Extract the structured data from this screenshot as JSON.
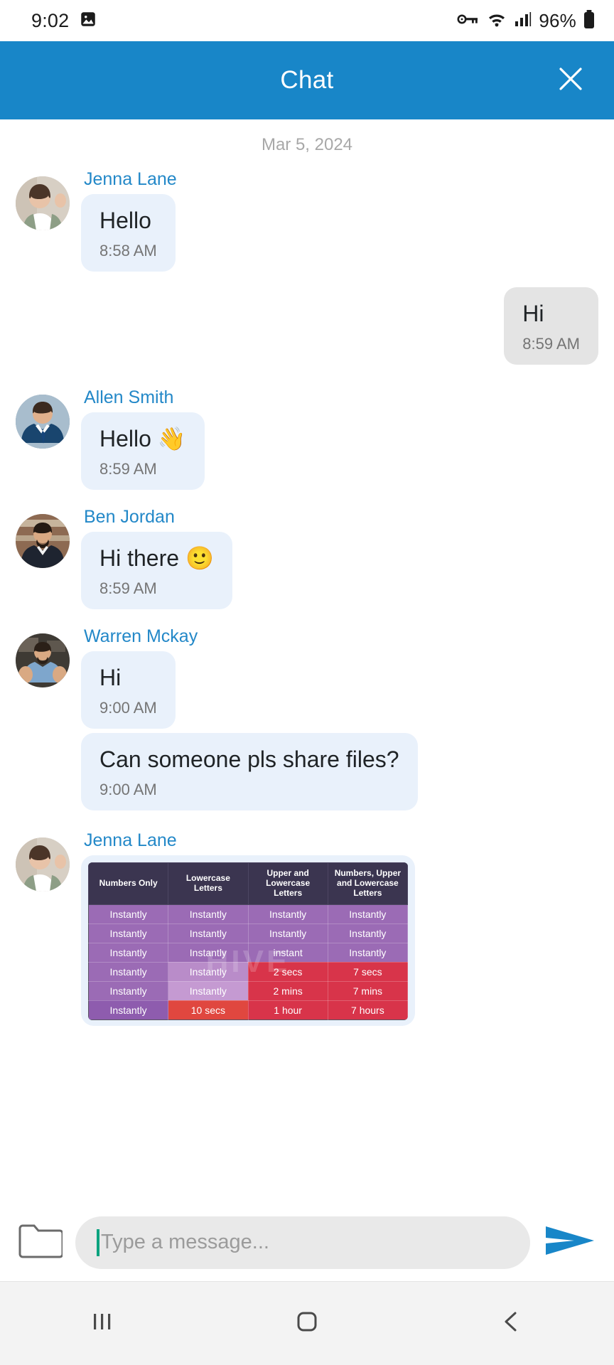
{
  "status_bar": {
    "time": "9:02",
    "battery_percent": "96%",
    "icons": [
      "image-icon",
      "vpn-key-icon",
      "wifi-icon",
      "signal-icon",
      "battery-icon"
    ]
  },
  "header": {
    "title": "Chat",
    "close_icon": "close-icon",
    "background_color": "#1886c8",
    "title_color": "#ffffff"
  },
  "conversation": {
    "date_divider": "Mar 5, 2024",
    "incoming_bubble_color": "#e9f1fb",
    "outgoing_bubble_color": "#e4e4e4",
    "sender_name_color": "#2388c8",
    "messages": [
      {
        "sender": "Jenna Lane",
        "text": "Hello",
        "time": "8:58 AM",
        "direction": "incoming",
        "avatar": "woman-waving-avatar",
        "show_avatar": true,
        "show_name": true,
        "type": "text"
      },
      {
        "sender": "",
        "text": "Hi",
        "time": "8:59 AM",
        "direction": "outgoing",
        "avatar": "",
        "show_avatar": false,
        "show_name": false,
        "type": "text"
      },
      {
        "sender": "Allen Smith",
        "text": "Hello 👋",
        "time": "8:59 AM",
        "direction": "incoming",
        "avatar": "man-suit-avatar",
        "show_avatar": true,
        "show_name": true,
        "type": "text"
      },
      {
        "sender": "Ben Jordan",
        "text": "Hi there 🙂",
        "time": "8:59 AM",
        "direction": "incoming",
        "avatar": "man-dark-blazer-avatar",
        "show_avatar": true,
        "show_name": true,
        "type": "text"
      },
      {
        "sender": "Warren Mckay",
        "text": "Hi",
        "time": "9:00 AM",
        "direction": "incoming",
        "avatar": "man-blue-shirt-avatar",
        "show_avatar": true,
        "show_name": true,
        "type": "text"
      },
      {
        "sender": "Warren Mckay",
        "text": "Can someone pls share files?",
        "time": "9:00 AM",
        "direction": "incoming",
        "avatar": "",
        "show_avatar": false,
        "show_name": false,
        "type": "text"
      },
      {
        "sender": "Jenna Lane",
        "text": "",
        "time": "",
        "direction": "incoming",
        "avatar": "woman-waving-avatar",
        "show_avatar": true,
        "show_name": true,
        "type": "image"
      }
    ]
  },
  "attachment_table": {
    "watermark": "HIVE",
    "headers": [
      "Numbers Only",
      "Lowercase Letters",
      "Upper and Lowercase Letters",
      "Numbers, Upper and Lowercase Letters"
    ],
    "rows": [
      [
        "Instantly",
        "Instantly",
        "Instantly",
        "Instantly"
      ],
      [
        "Instantly",
        "Instantly",
        "Instantly",
        "Instantly"
      ],
      [
        "Instantly",
        "Instantly",
        "instant",
        "Instantly"
      ],
      [
        "Instantly",
        "Instantly",
        "2 secs",
        "7 secs"
      ],
      [
        "Instantly",
        "Instantly",
        "2 mins",
        "7 mins"
      ],
      [
        "Instantly",
        "10 secs",
        "1 hour",
        "7 hours"
      ]
    ],
    "row_colors": [
      [
        "#9b6bb5",
        "#9b6bb5",
        "#9b6bb5",
        "#9b6bb5"
      ],
      [
        "#9b6bb5",
        "#9b6bb5",
        "#9b6bb5",
        "#9b6bb5"
      ],
      [
        "#9b6bb5",
        "#9b6bb5",
        "#9b6bb5",
        "#9b6bb5"
      ],
      [
        "#9b6bb5",
        "#b98cc9",
        "#d8344a",
        "#d8344a"
      ],
      [
        "#9b6bb5",
        "#c59ad2",
        "#d8344a",
        "#d8344a"
      ],
      [
        "#8e5cae",
        "#e0473f",
        "#d8344a",
        "#d8344a"
      ]
    ]
  },
  "composer": {
    "attach_icon": "folder-icon",
    "placeholder": "Type a message...",
    "value": "",
    "send_icon": "send-icon",
    "send_color": "#1886c8"
  },
  "navbar": {
    "recents_icon": "recents-icon",
    "home_icon": "home-icon",
    "back_icon": "back-icon"
  }
}
